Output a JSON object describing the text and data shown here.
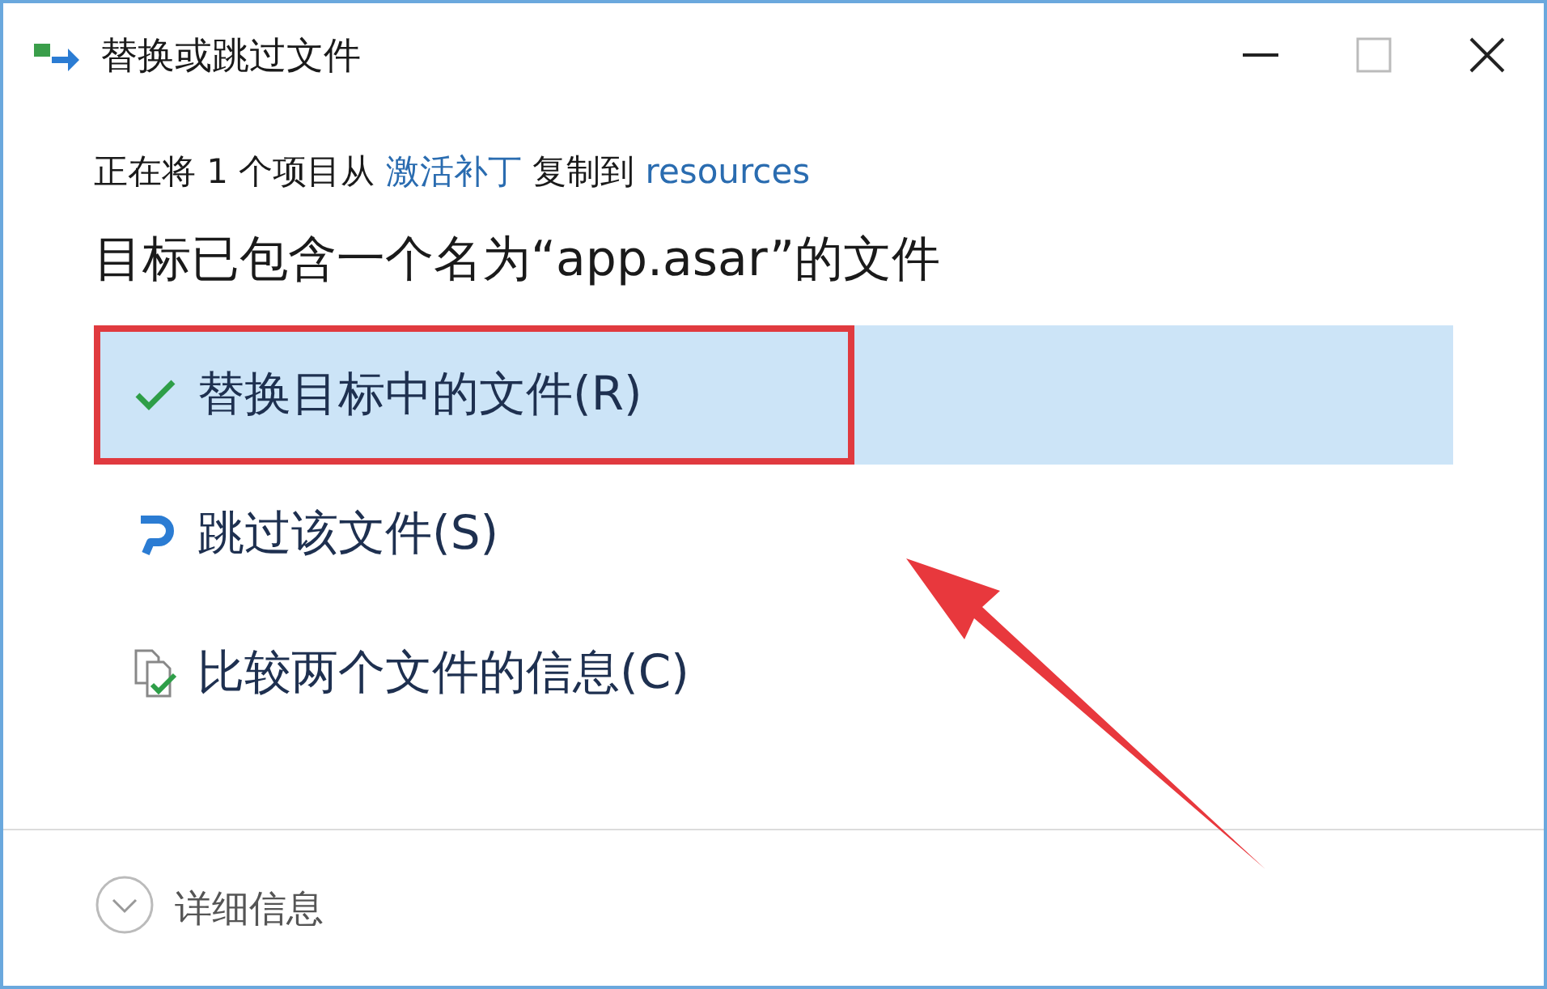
{
  "window": {
    "title": "替换或跳过文件"
  },
  "copy_line": [
    {
      "kind": "plain",
      "text": "正在将 1 个项目从"
    },
    {
      "kind": "link",
      "text": "激活补丁"
    },
    {
      "kind": "plain",
      "text": "复制到"
    },
    {
      "kind": "link",
      "text": "resources"
    }
  ],
  "heading": "目标已包含一个名为“app.asar”的文件",
  "options": [
    {
      "kind": "replace",
      "label": "替换目标中的文件(R)",
      "selected": true,
      "annotated": true
    },
    {
      "kind": "skip",
      "label": "跳过该文件(S)",
      "selected": false,
      "annotated": false
    },
    {
      "kind": "compare",
      "label": "比较两个文件的信息(C)",
      "selected": false,
      "annotated": false
    }
  ],
  "details": {
    "label": "详细信息",
    "expanded": false
  }
}
